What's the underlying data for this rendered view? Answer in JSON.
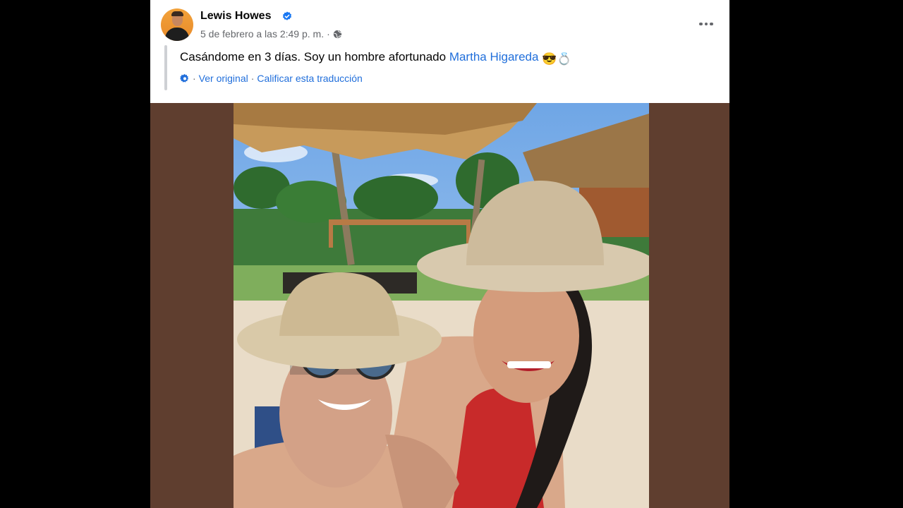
{
  "post": {
    "author": "Lewis Howes",
    "timestamp": "5 de febrero a las 2:49 p. m.",
    "meta_separator": "·",
    "privacy_icon": "globe-icon",
    "text_before_mention": "Casándome en 3 días. Soy un hombre afortunado ",
    "mention": "Martha Higareda",
    "emojis": "😎💍",
    "translation": {
      "view_original": "Ver original",
      "separator": "·",
      "rate": "Calificar esta traducción"
    }
  },
  "colors": {
    "link": "#216fdb",
    "meta": "#65676b",
    "media_background": "#5f3e2f",
    "page_background": "#000000"
  }
}
